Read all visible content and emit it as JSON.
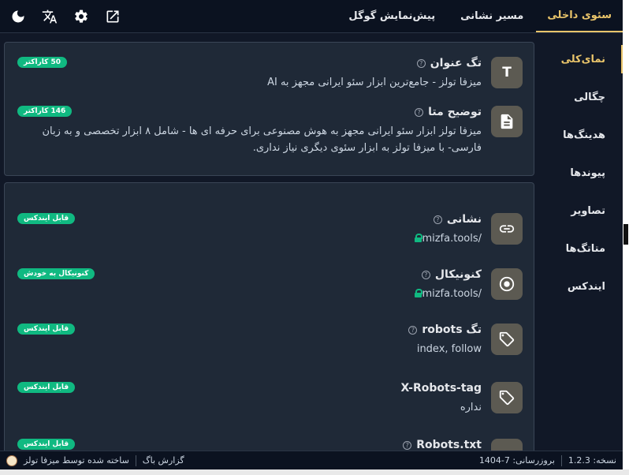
{
  "topbar": {
    "tabs": [
      {
        "label": "سئوی داخلی",
        "active": true
      },
      {
        "label": "مسیر نشانی",
        "active": false
      },
      {
        "label": "پیش‌نمایش گوگل",
        "active": false
      }
    ],
    "tools": [
      "external-link-icon",
      "gear-icon",
      "translate-icon",
      "moon-icon"
    ]
  },
  "sidebar": {
    "items": [
      {
        "label": "نمای‌کلی",
        "active": true
      },
      {
        "label": "چگالی"
      },
      {
        "label": "هدینگ‌ها"
      },
      {
        "label": "پیوندها"
      },
      {
        "label": "تصاویر"
      },
      {
        "label": "متاتگ‌ها"
      },
      {
        "label": "ایندکس"
      }
    ]
  },
  "overview": {
    "title_tag": {
      "label": "تگ عنوان",
      "value": "میزفا تولز - جامع‌ترین ابزار سئو ایرانی مجهز به AI",
      "badge": "50 کاراکتر",
      "icon_letter": "T"
    },
    "meta_desc": {
      "label": "توضیح متا",
      "value": "میزفا تولز ابزار سئو ایرانی مجهز به هوش مصنوعی برای حرفه ای ها - شامل ۸ ابزار تخصصی و به زبان فارسی- با میزفا تولز به ابزار سئوی دیگری نیاز نداری.",
      "badge": "146 کاراکتر"
    },
    "url": {
      "label": "نشانی",
      "value": "mizfa.tools/",
      "badge": "قابل ایندکس"
    },
    "canonical": {
      "label": "کنونیکال",
      "value": "mizfa.tools/",
      "badge": "کنونیکال به خودش"
    },
    "robots_tag": {
      "label": "تگ robots",
      "value": "index, follow",
      "badge": "قابل ایندکس"
    },
    "x_robots": {
      "label": "X-Robots-tag",
      "value": "نداره",
      "badge": "قابل ایندکس"
    },
    "robots_txt": {
      "label": "Robots.txt",
      "badge": "قابل ایندکس"
    }
  },
  "footer": {
    "version_label": "نسخه: 1.2.3",
    "updated_label": "بروزرسانی: 7-1404",
    "bug_report": "گزارش باگ",
    "made_by": "ساخته شده توسط میزفا تولز"
  },
  "colors": {
    "accent": "#e9c46a",
    "badge_green": "#10b981",
    "panel_bg": "#1f2937",
    "app_bg": "#111827"
  }
}
